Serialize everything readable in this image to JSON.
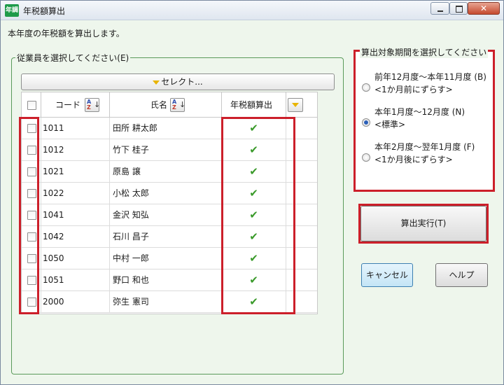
{
  "window": {
    "title": "年税額算出",
    "app_icon_text": "年調"
  },
  "instruction": "本年度の年税額を算出します。",
  "employee_group": {
    "label": "従業員を選択してください(E)",
    "select_button": "セレクト...",
    "columns": {
      "code": "コード",
      "name": "氏名",
      "tax": "年税額算出"
    },
    "rows": [
      {
        "code": "1011",
        "name": "田所 耕太郎",
        "selected": false,
        "tax_checked": true
      },
      {
        "code": "1012",
        "name": "竹下 桂子",
        "selected": false,
        "tax_checked": true
      },
      {
        "code": "1021",
        "name": "原島 譲",
        "selected": false,
        "tax_checked": true
      },
      {
        "code": "1022",
        "name": "小松 太郎",
        "selected": false,
        "tax_checked": true
      },
      {
        "code": "1041",
        "name": "金沢 知弘",
        "selected": false,
        "tax_checked": true
      },
      {
        "code": "1042",
        "name": "石川 昌子",
        "selected": false,
        "tax_checked": true
      },
      {
        "code": "1050",
        "name": "中村 一郎",
        "selected": false,
        "tax_checked": true
      },
      {
        "code": "1051",
        "name": "野口 和也",
        "selected": false,
        "tax_checked": true
      },
      {
        "code": "2000",
        "name": "弥生 憲司",
        "selected": false,
        "tax_checked": true
      }
    ]
  },
  "period_group": {
    "label": "算出対象期間を選択してください",
    "options": [
      {
        "line1": "前年12月度～本年11月度 (B)",
        "line2": "<1か月前にずらす>",
        "selected": false
      },
      {
        "line1": "本年1月度～12月度 (N)",
        "line2": "<標準>",
        "selected": true
      },
      {
        "line1": "本年2月度～翌年1月度 (F)",
        "line2": "<1か月後にずらす>",
        "selected": false
      }
    ]
  },
  "buttons": {
    "run": "算出実行(T)",
    "cancel": "キャンセル",
    "help": "ヘルプ"
  },
  "colors": {
    "highlight": "#cc1f2a",
    "window_bg": "#eef6ec",
    "check_green": "#3a9a2a",
    "radio_selected": "#2b5fb8"
  }
}
